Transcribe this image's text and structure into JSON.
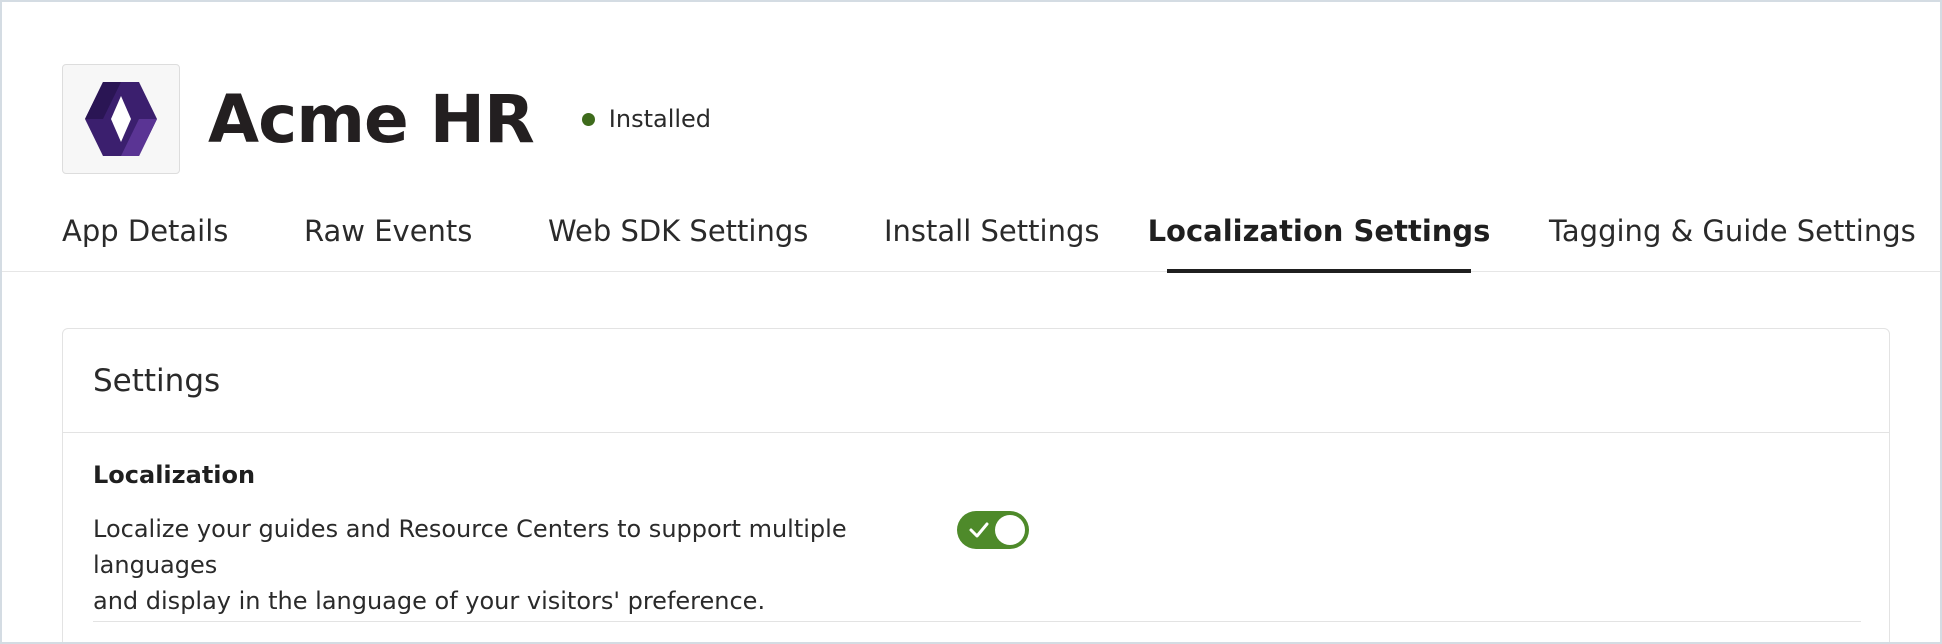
{
  "app": {
    "title": "Acme HR",
    "status": "Installed",
    "status_color": "#3e6b1c",
    "logo_icon": "hexagon-diamond-logo",
    "logo_color": "#4a2a80"
  },
  "tabs": [
    {
      "label": "App Details",
      "active": false
    },
    {
      "label": "Raw Events",
      "active": false
    },
    {
      "label": "Web SDK Settings",
      "active": false
    },
    {
      "label": "Install Settings",
      "active": false
    },
    {
      "label": "Localization Settings",
      "active": true
    },
    {
      "label": "Tagging & Guide Settings",
      "active": false
    }
  ],
  "settings": {
    "title": "Settings",
    "localization": {
      "heading": "Localization",
      "description_line1": "Localize your guides and Resource Centers to support multiple languages",
      "description_line2": "and display in the language of your visitors' preference.",
      "toggle_on": true,
      "toggle_color": "#4e8a2a"
    }
  }
}
